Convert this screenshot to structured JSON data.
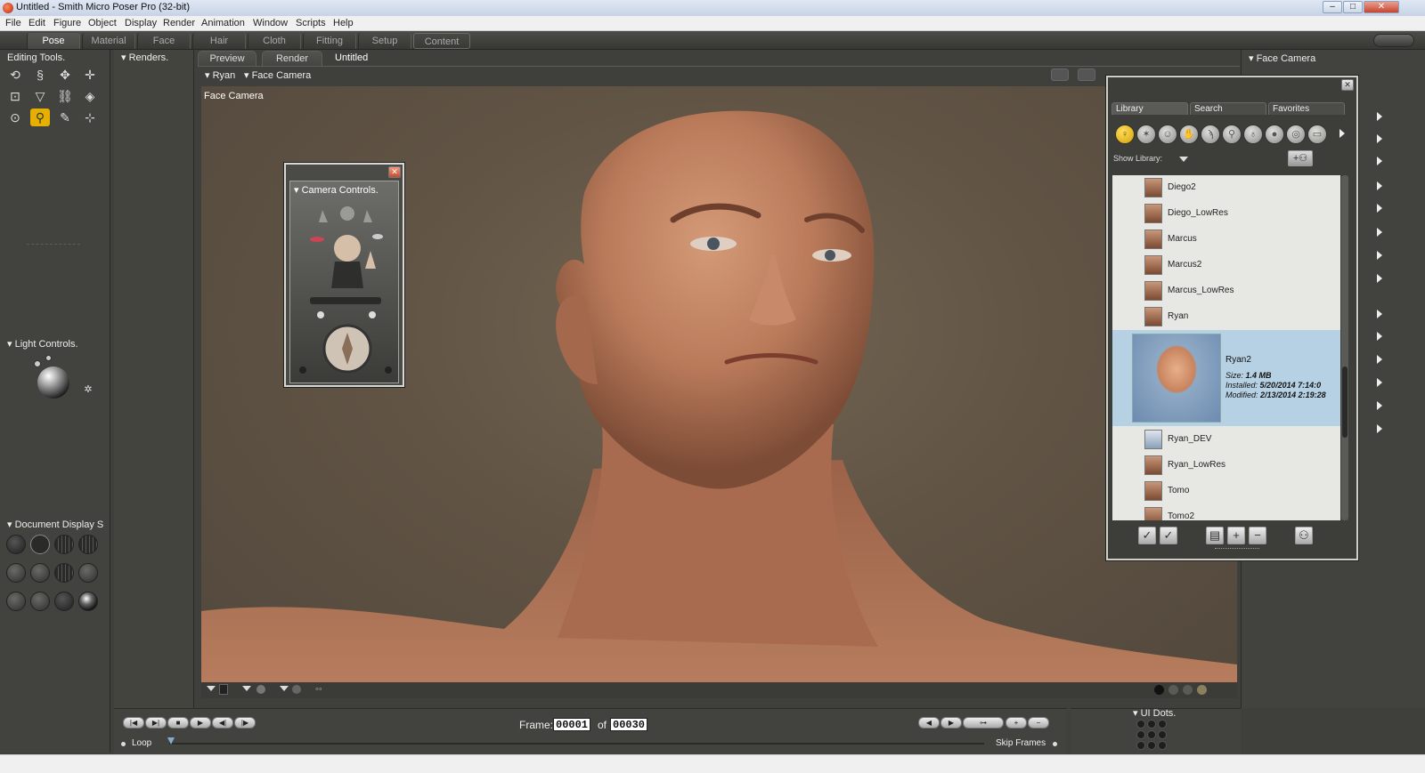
{
  "window": {
    "title": "Untitled - Smith Micro Poser Pro  (32-bit)"
  },
  "menu": [
    "File",
    "Edit",
    "Figure",
    "Object",
    "Display",
    "Render",
    "Animation",
    "Window",
    "Scripts",
    "Help"
  ],
  "rooms": [
    "Pose",
    "Material",
    "Face",
    "Hair",
    "Cloth",
    "Fitting",
    "Setup",
    "Content"
  ],
  "left": {
    "editing_tools": "Editing Tools.",
    "light_controls": "Light Controls.",
    "document_display": "Document Display S"
  },
  "renders": {
    "title": "Renders."
  },
  "doc_tabs": {
    "preview": "Preview",
    "render": "Render",
    "doc_name": "Untitled"
  },
  "viewport": {
    "figure_menu": "Ryan",
    "camera_menu": "Face Camera",
    "camera_label": "Face Camera"
  },
  "camera_controls": {
    "title": "Camera Controls."
  },
  "library": {
    "tabs": [
      "Library",
      "Search",
      "Favorites"
    ],
    "show_library": "Show Library:",
    "items": [
      "Diego2",
      "Diego_LowRes",
      "Marcus",
      "Marcus2",
      "Marcus_LowRes",
      "Ryan"
    ],
    "selected": {
      "name": "Ryan2",
      "size_label": "Size:",
      "size": "1.4 MB",
      "installed_label": "Installed:",
      "installed": "5/20/2014 7:14:0",
      "modified_label": "Modified:",
      "modified": "2/13/2014 2:19:28"
    },
    "items_after": [
      "Ryan_DEV",
      "Ryan_LowRes",
      "Tomo",
      "Tomo2"
    ]
  },
  "right_panel": {
    "title": "Face Camera"
  },
  "animation": {
    "frame_label": "Frame:",
    "frame": "00001",
    "of_label": "of",
    "total": "00030",
    "loop": "Loop",
    "skip_frames": "Skip Frames"
  },
  "ui_dots": {
    "title": "UI Dots."
  },
  "colors": {
    "accent": "#e5b000",
    "selection": "#b7d1e4",
    "viewport_bg": "#615445"
  }
}
